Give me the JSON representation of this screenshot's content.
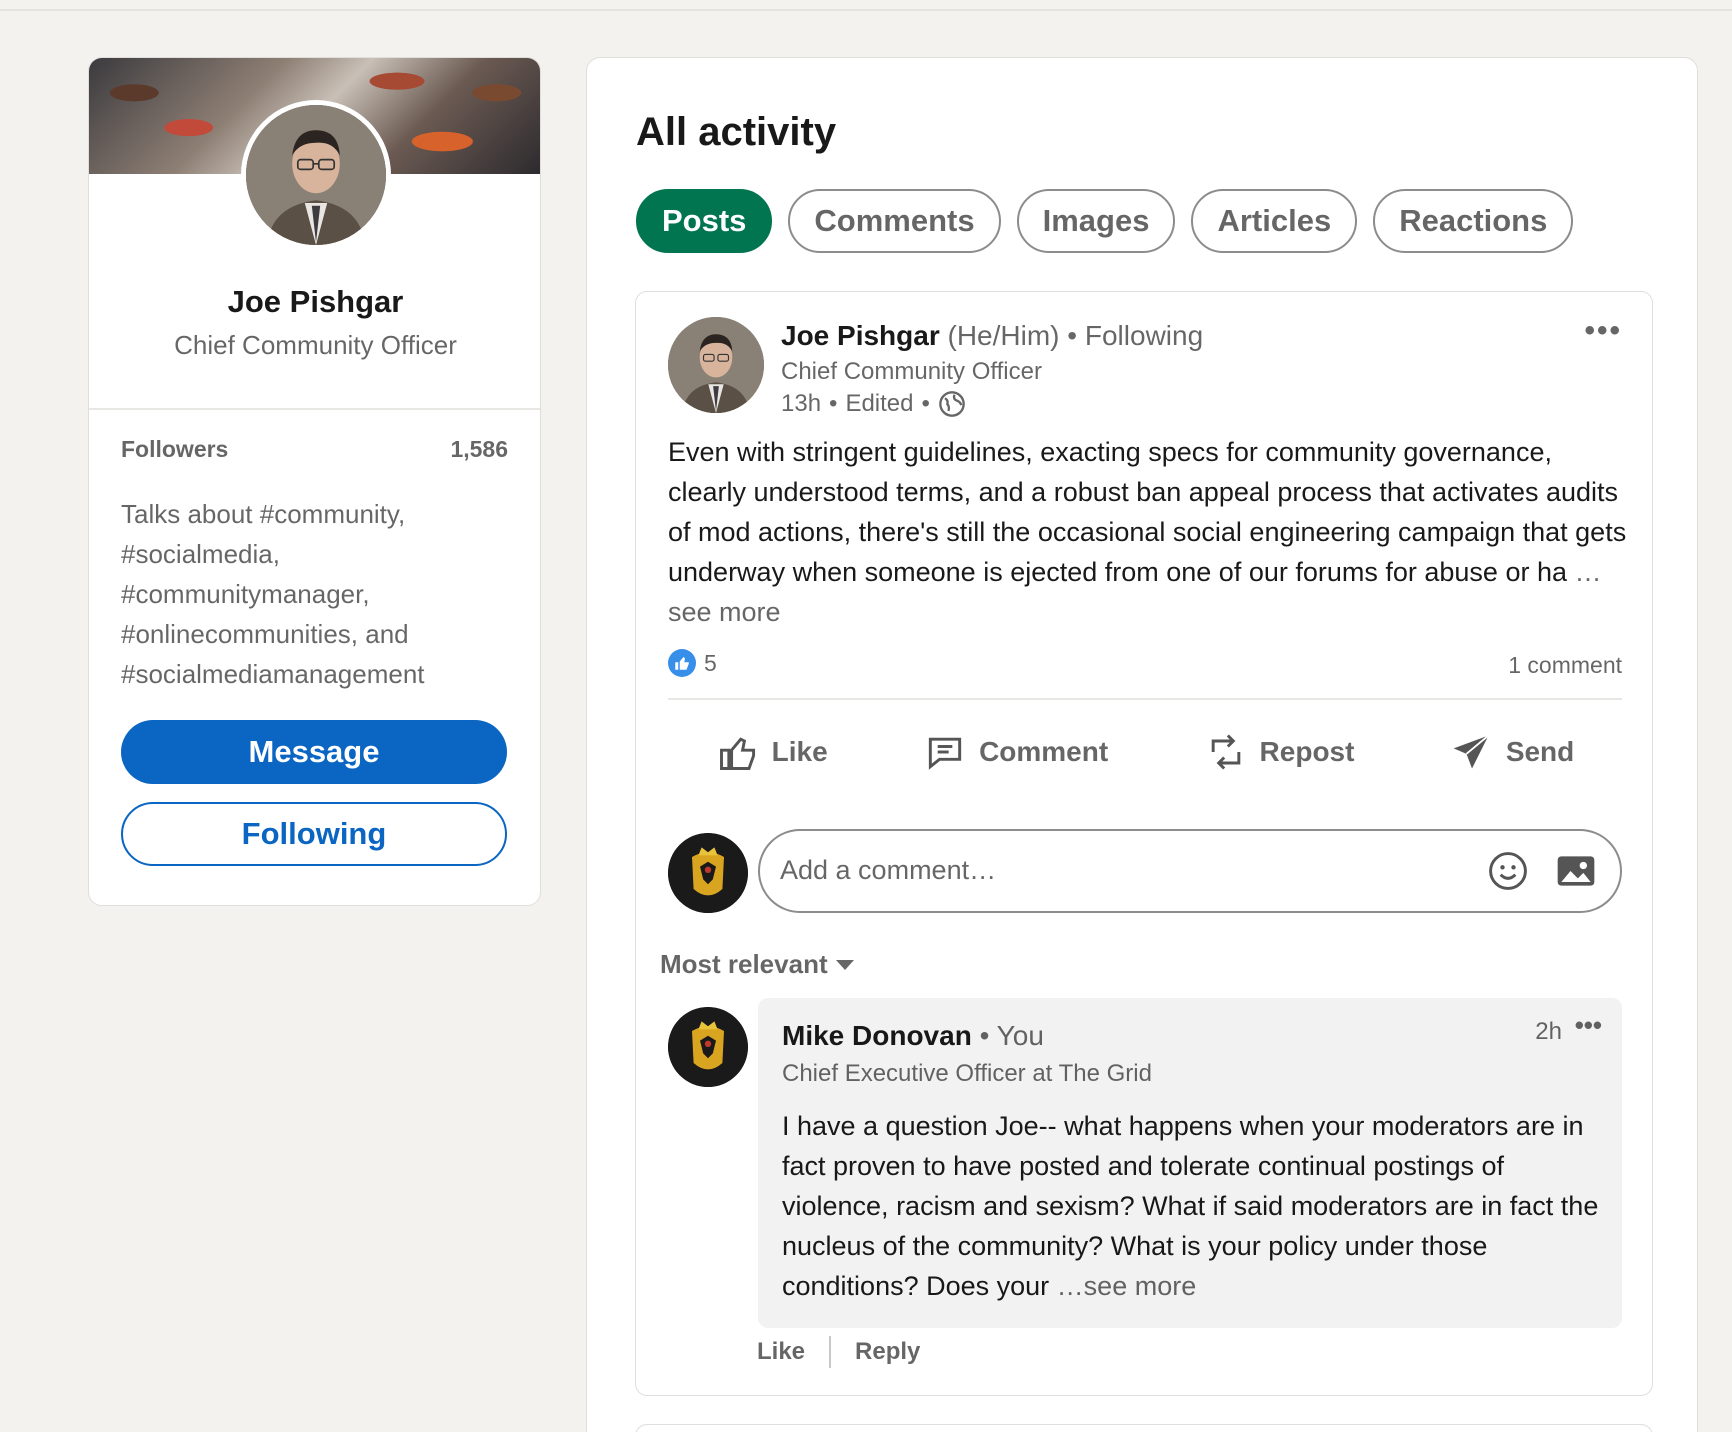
{
  "profile": {
    "name": "Joe Pishgar",
    "title": "Chief Community Officer",
    "followers_label": "Followers",
    "followers_count": "1,586",
    "talks_about": "Talks about #community, #socialmedia, #communitymanager, #onlinecommunities, and #socialmediamanagement",
    "message_label": "Message",
    "following_label": "Following"
  },
  "activity": {
    "title": "All activity",
    "tabs": [
      {
        "label": "Posts",
        "active": true
      },
      {
        "label": "Comments",
        "active": false
      },
      {
        "label": "Images",
        "active": false
      },
      {
        "label": "Articles",
        "active": false
      },
      {
        "label": "Reactions",
        "active": false
      }
    ]
  },
  "post": {
    "author": "Joe Pishgar",
    "pronouns": "(He/Him)",
    "following": "• Following",
    "subtitle": "Chief Community Officer",
    "time": "13h",
    "edited": "Edited",
    "body": "Even with stringent guidelines, exacting specs for community governance, clearly understood terms, and a robust ban appeal process that activates audits of mod actions, there's still the occasional social engineering campaign that gets underway when someone is ejected from one of our forums for abuse or ha",
    "see_more": "…see more",
    "reaction_count": "5",
    "comment_count": "1 comment",
    "actions": {
      "like": "Like",
      "comment": "Comment",
      "repost": "Repost",
      "send": "Send"
    },
    "comment_placeholder": "Add a comment…",
    "sort_label": "Most relevant"
  },
  "comment": {
    "author": "Mike Donovan",
    "you": "• You",
    "subtitle": "Chief Executive Officer at The Grid",
    "time": "2h",
    "body": "I have a question Joe-- what happens when your moderators are in fact proven to have posted and tolerate continual postings of violence, racism and sexism? What if said moderators are in fact the nucleus of the community? What is your policy under those conditions? Does your",
    "see_more": "…see more",
    "like": "Like",
    "reply": "Reply"
  },
  "colors": {
    "primary_blue": "#0a66c2",
    "active_tab_green": "#01754f",
    "background": "#f3f2ef"
  },
  "icons": [
    "globe-icon",
    "more-icon",
    "like-icon",
    "comment-icon",
    "repost-icon",
    "send-icon",
    "emoji-icon",
    "image-icon",
    "caret-down-icon",
    "like-reaction-icon"
  ]
}
